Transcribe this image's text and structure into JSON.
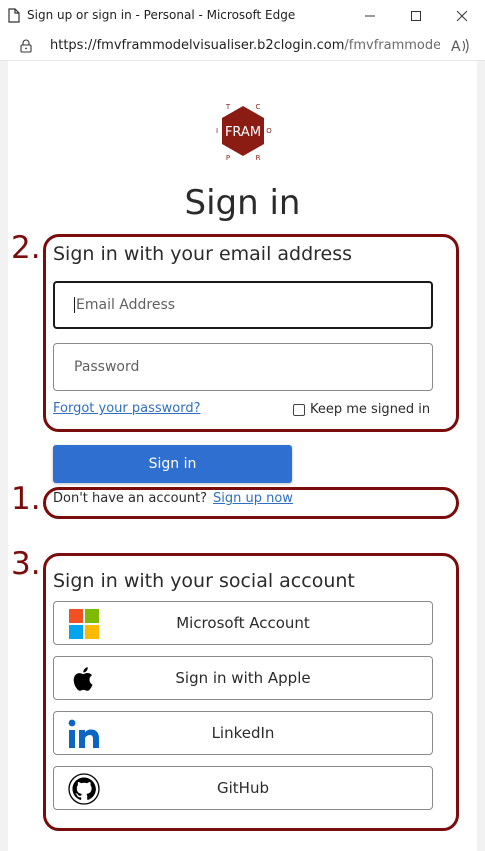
{
  "window": {
    "title": "Sign up or sign in - Personal - Microsoft Edge",
    "url_host": "https://fmvframmodelvisualiser.b2clogin.com",
    "url_rest": "/fmvframmodel..."
  },
  "logo": {
    "text": "FRAM",
    "letters": {
      "top_left": "T",
      "top_right": "C",
      "left": "I",
      "right": "O",
      "bottom_left": "P",
      "bottom_right": "R"
    },
    "color": "#8b1c14"
  },
  "page": {
    "heading": "Sign in"
  },
  "local_account": {
    "title": "Sign in with your email address",
    "email_placeholder": "Email Address",
    "password_placeholder": "Password",
    "forgot_password": "Forgot your password?",
    "keep_signed_in": "Keep me signed in",
    "keep_signed_in_checked": false,
    "sign_in_button": "Sign in",
    "no_account_text": "Don't have an account?",
    "sign_up_link": "Sign up now"
  },
  "social": {
    "title": "Sign in with your social account",
    "providers": [
      {
        "label": "Microsoft Account",
        "icon": "microsoft-logo-icon"
      },
      {
        "label": "Sign in with Apple",
        "icon": "apple-logo-icon"
      },
      {
        "label": "LinkedIn",
        "icon": "linkedin-logo-icon"
      },
      {
        "label": "GitHub",
        "icon": "github-logo-icon"
      }
    ]
  },
  "annotations": {
    "first": "1.",
    "second": "2.",
    "third": "3.",
    "color": "#7a0c0c"
  },
  "colors": {
    "primary_button": "#2f6fd0",
    "link": "#2f6fbf"
  }
}
